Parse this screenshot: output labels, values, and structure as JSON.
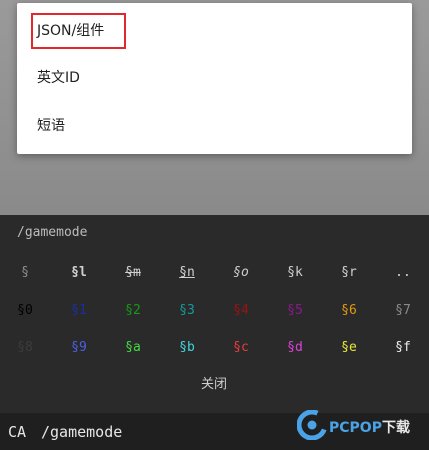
{
  "menu": {
    "items": [
      {
        "label": "JSON/组件"
      },
      {
        "label": "英文ID"
      },
      {
        "label": "短语"
      }
    ],
    "highlight_color": "#e0282d"
  },
  "panel": {
    "command_text": "/gamemode",
    "format_codes": [
      [
        {
          "label": "§",
          "color": "#8c8c8c",
          "style": "plain"
        },
        {
          "label": "§l",
          "color": "#cfcfcf",
          "style": "bold"
        },
        {
          "label": "§m",
          "color": "#cfcfcf",
          "style": "strikethrough"
        },
        {
          "label": "§n",
          "color": "#cfcfcf",
          "style": "underline"
        },
        {
          "label": "§o",
          "color": "#cfcfcf",
          "style": "italic"
        },
        {
          "label": "§k",
          "color": "#cfcfcf",
          "style": "plain"
        },
        {
          "label": "§r",
          "color": "#cfcfcf",
          "style": "plain"
        },
        {
          "label": "..",
          "color": "#cfcfcf",
          "style": "plain"
        }
      ],
      [
        {
          "label": "§0",
          "color": "#000000",
          "style": "plain"
        },
        {
          "label": "§1",
          "color": "#1a2fa8",
          "style": "plain"
        },
        {
          "label": "§2",
          "color": "#139b13",
          "style": "plain"
        },
        {
          "label": "§3",
          "color": "#159a9a",
          "style": "plain"
        },
        {
          "label": "§4",
          "color": "#9c1212",
          "style": "plain"
        },
        {
          "label": "§5",
          "color": "#8c198c",
          "style": "plain"
        },
        {
          "label": "§6",
          "color": "#e09a12",
          "style": "plain"
        },
        {
          "label": "§7",
          "color": "#8a8a8a",
          "style": "plain"
        }
      ],
      [
        {
          "label": "§8",
          "color": "#3c3c3c",
          "style": "plain"
        },
        {
          "label": "§9",
          "color": "#4a5fe8",
          "style": "plain"
        },
        {
          "label": "§a",
          "color": "#3fdc3f",
          "style": "plain"
        },
        {
          "label": "§b",
          "color": "#3fd6dc",
          "style": "plain"
        },
        {
          "label": "§c",
          "color": "#e83c3c",
          "style": "plain"
        },
        {
          "label": "§d",
          "color": "#dc40dc",
          "style": "plain"
        },
        {
          "label": "§e",
          "color": "#e8e83c",
          "style": "plain"
        },
        {
          "label": "§f",
          "color": "#ececec",
          "style": "plain"
        }
      ]
    ],
    "close_label": "关闭"
  },
  "input_bar": {
    "ca_label": "CA",
    "command_value": "/gamemode"
  },
  "watermark": {
    "brand": "PCPOP",
    "suffix": "下载",
    "icon": "pcpop-logo-icon",
    "color": "#4aa3e6"
  }
}
